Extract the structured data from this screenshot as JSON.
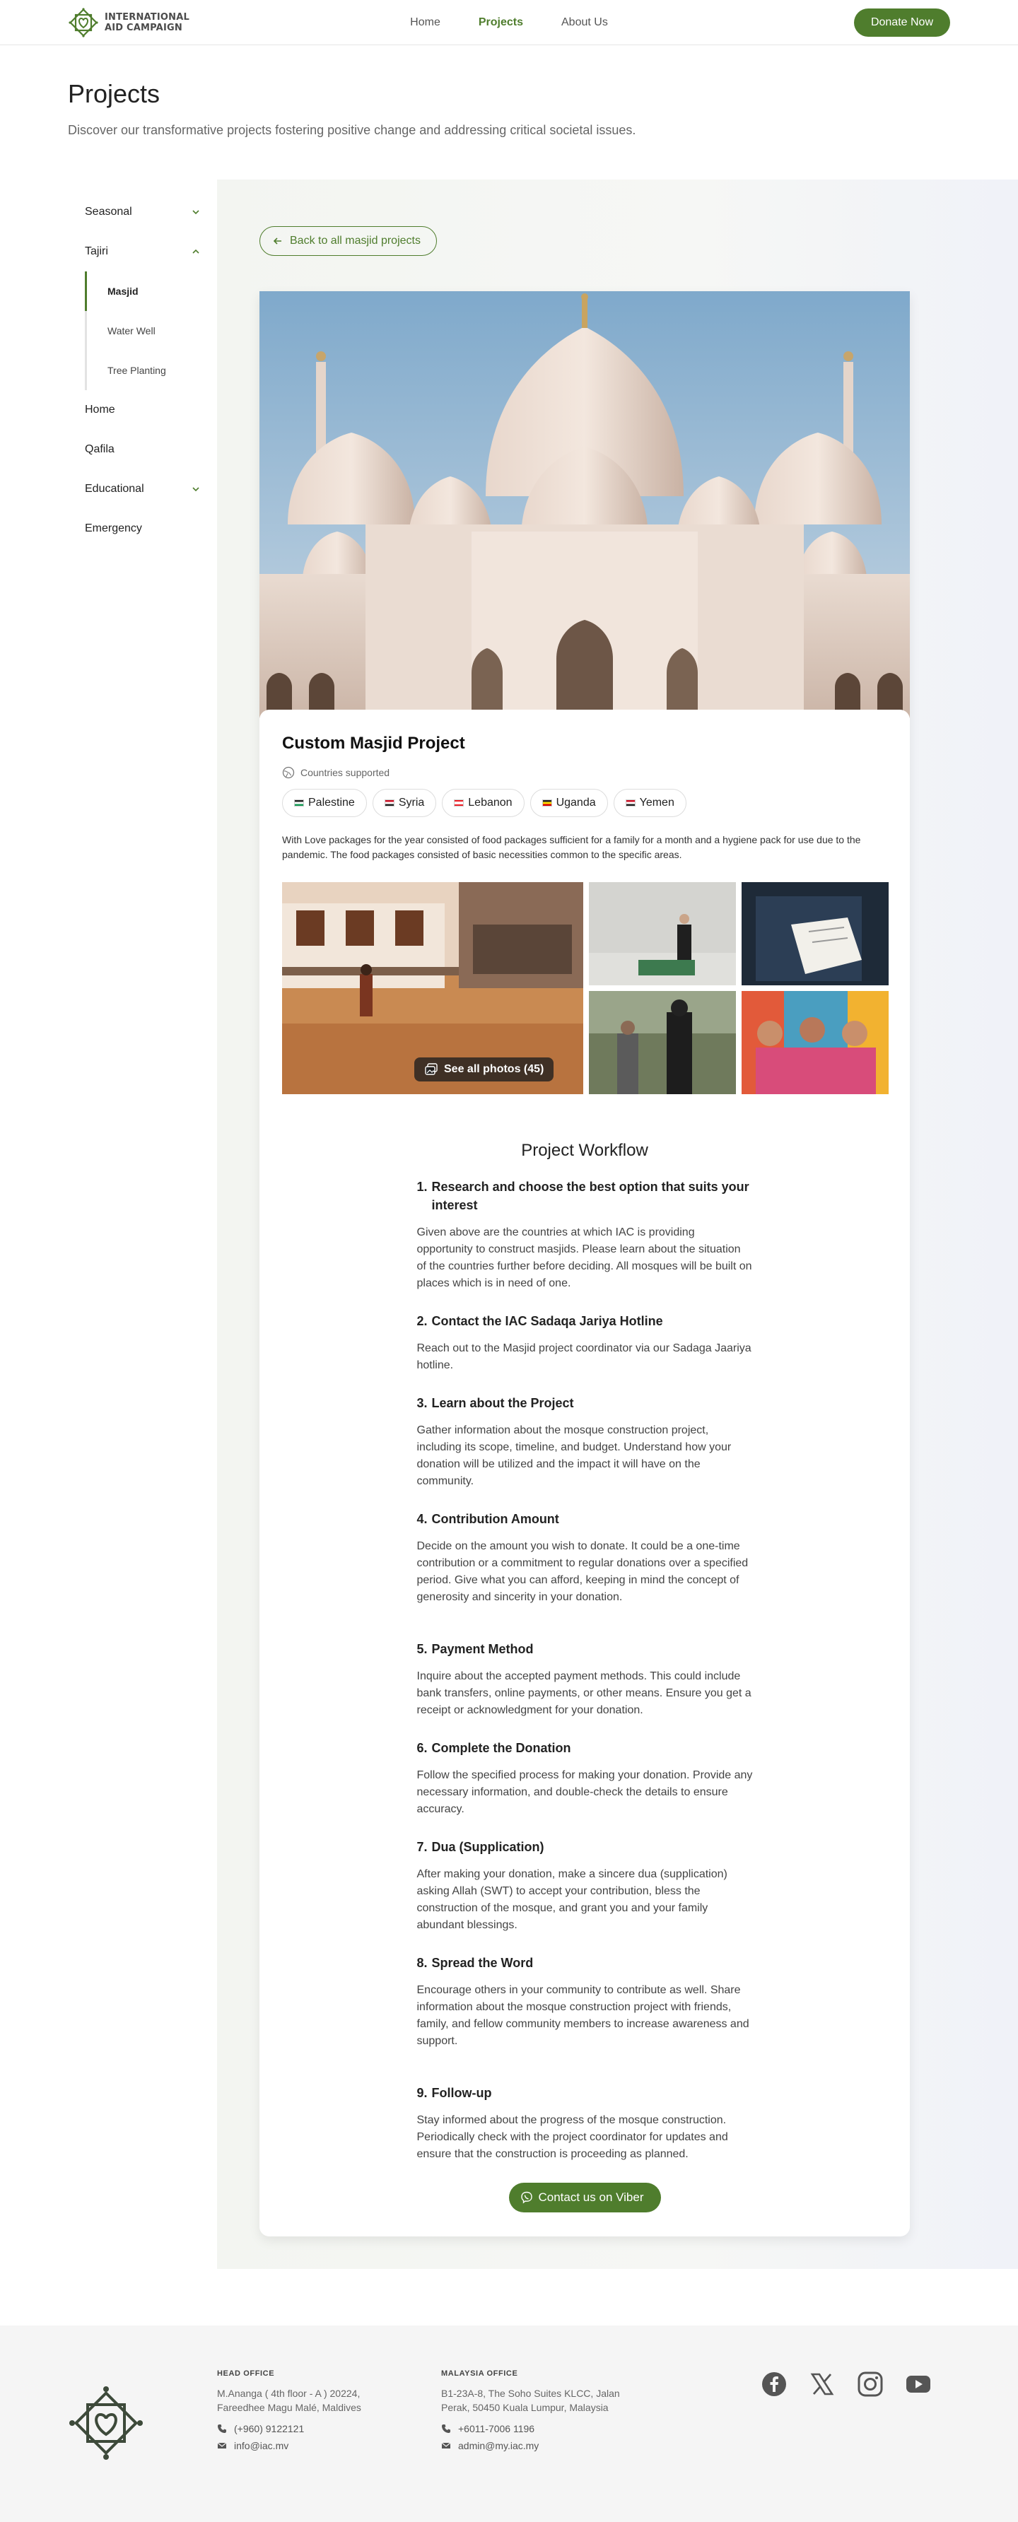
{
  "header": {
    "logo_line1": "INTERNATIONAL",
    "logo_line2": "AID CAMPAIGN",
    "nav": [
      {
        "label": "Home"
      },
      {
        "label": "Projects"
      },
      {
        "label": "About Us"
      }
    ],
    "donate_label": "Donate Now",
    "accent_color": "#4f7d2d"
  },
  "page": {
    "title": "Projects",
    "subtitle": "Discover our transformative projects fostering positive change and addressing critical societal issues."
  },
  "sidebar": {
    "items": [
      {
        "label": "Seasonal"
      },
      {
        "label": "Tajiri"
      },
      {
        "label": "Home"
      },
      {
        "label": "Qafila"
      },
      {
        "label": "Educational"
      },
      {
        "label": "Emergency"
      }
    ],
    "sub_items": [
      {
        "label": "Masjid"
      },
      {
        "label": "Water Well"
      },
      {
        "label": "Tree Planting"
      }
    ]
  },
  "content": {
    "back_label": "Back to all masjid projects",
    "card_title": "Custom Masjid Project",
    "countries_label": "Countries supported",
    "countries": [
      {
        "name": "Palestine"
      },
      {
        "name": "Syria"
      },
      {
        "name": "Lebanon"
      },
      {
        "name": "Uganda"
      },
      {
        "name": "Yemen"
      }
    ],
    "description": "With Love packages for the year consisted of food packages sufficient for a family for a month and a hygiene pack for use due to the pandemic. The food packages consisted of basic necessities common to the specific areas.",
    "see_all_label": "See all photos (45)"
  },
  "workflow": {
    "title": "Project Workflow",
    "steps": [
      {
        "num": "1.",
        "heading": "Research and choose the best option that suits your interest",
        "text": "Given above are the countries at which IAC is providing opportunity to construct masjids. Please learn about the situation of the countries further before deciding. All mosques will be built on places which is in need of one."
      },
      {
        "num": "2.",
        "heading": "Contact the IAC Sadaqa Jariya Hotline",
        "text": "Reach out to the Masjid project coordinator via our Sadaga Jaariya hotline."
      },
      {
        "num": "3.",
        "heading": "Learn about the Project",
        "text": "Gather information about the mosque construction project, including its scope, timeline, and budget. Understand how your donation will be utilized and the impact it will have on the community."
      },
      {
        "num": "4.",
        "heading": "Contribution Amount",
        "text": "Decide on the amount you wish to donate. It could be a one-time contribution or a commitment to regular donations over a specified period. Give what you can afford, keeping in mind the concept of generosity and sincerity in your donation."
      },
      {
        "num": "5.",
        "heading": "Payment Method",
        "text": "Inquire about the accepted payment methods. This could include bank transfers, online payments, or other means. Ensure you get a receipt or acknowledgment for your donation."
      },
      {
        "num": "6.",
        "heading": "Complete the Donation",
        "text": "Follow the specified process for making your donation. Provide any necessary information, and double-check the details to ensure accuracy."
      },
      {
        "num": "7.",
        "heading": "Dua (Supplication)",
        "text": "After making your donation, make a sincere dua (supplication) asking Allah (SWT) to accept your contribution, bless the construction of the mosque, and grant you and your family abundant blessings."
      },
      {
        "num": "8.",
        "heading": "Spread the Word",
        "text": "Encourage others in your community to contribute as well. Share information about the mosque construction project with friends, family, and fellow community members to increase awareness and support."
      },
      {
        "num": "9.",
        "heading": "Follow-up",
        "text": "Stay informed about the progress of the mosque construction. Periodically check with the project coordinator for updates and ensure that the construction is proceeding as planned."
      }
    ],
    "viber_label": "Contact us on Viber"
  },
  "footer": {
    "head_office": {
      "heading": "HEAD OFFICE",
      "address": "M.Ananga ( 4th floor - A ) 20224, Fareedhee Magu Malé, Maldives",
      "phone": "(+960) 9122121",
      "email": "info@iac.mv"
    },
    "malaysia_office": {
      "heading": "MALAYSIA OFFICE",
      "address": "B1-23A-8, The Soho Suites KLCC, Jalan Perak, 50450 Kuala Lumpur, Malaysia",
      "phone": "+6011-7006 1196",
      "email": "admin@my.iac.my"
    },
    "socials": [
      "facebook-icon",
      "x-icon",
      "instagram-icon",
      "youtube-icon"
    ]
  }
}
